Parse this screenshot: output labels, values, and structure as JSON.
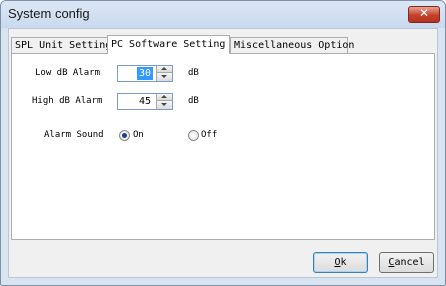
{
  "window": {
    "title": "System config"
  },
  "tabs": [
    {
      "label": "SPL Unit Setting"
    },
    {
      "label": "PC Software Setting"
    },
    {
      "label": "Miscellaneous Option"
    }
  ],
  "active_tab": "PC Software Setting",
  "fields": {
    "low_db_alarm": {
      "label": "Low dB Alarm",
      "value": "30",
      "unit": "dB"
    },
    "high_db_alarm": {
      "label": "High dB Alarm",
      "value": "45",
      "unit": "dB"
    }
  },
  "alarm_sound": {
    "label": "Alarm Sound",
    "options": [
      {
        "label": "On",
        "checked": true
      },
      {
        "label": "Off",
        "checked": false
      }
    ]
  },
  "buttons": {
    "ok": {
      "mnemonic": "O",
      "rest": "k"
    },
    "cancel": {
      "mnemonic": "C",
      "rest": "ancel"
    }
  }
}
